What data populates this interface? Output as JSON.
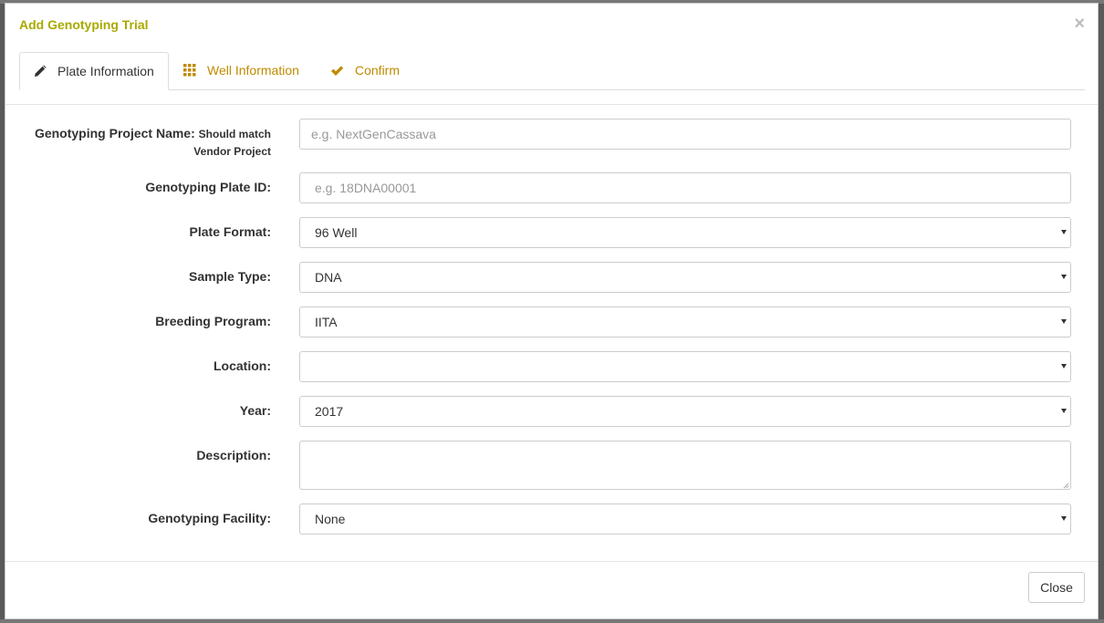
{
  "modal": {
    "title": "Add Genotyping Trial",
    "close_symbol": "×",
    "close_button": "Close"
  },
  "tabs": [
    {
      "label": "Plate Information",
      "icon": "pencil-icon",
      "active": true
    },
    {
      "label": "Well Information",
      "icon": "grid-icon",
      "active": false
    },
    {
      "label": "Confirm",
      "icon": "checkmark-icon",
      "active": false
    }
  ],
  "form": {
    "project_name": {
      "label": "Genotyping Project Name:",
      "hint": "Should match Vendor Project",
      "placeholder": "e.g. NextGenCassava",
      "value": ""
    },
    "plate_id": {
      "label": "Genotyping Plate ID:",
      "placeholder": "e.g. 18DNA00001",
      "value": ""
    },
    "plate_format": {
      "label": "Plate Format:",
      "value": "96 Well"
    },
    "sample_type": {
      "label": "Sample Type:",
      "value": "DNA"
    },
    "breeding_program": {
      "label": "Breeding Program:",
      "value": "IITA"
    },
    "location": {
      "label": "Location:",
      "value": ""
    },
    "year": {
      "label": "Year:",
      "value": "2017"
    },
    "description": {
      "label": "Description:",
      "value": ""
    },
    "genotyping_facility": {
      "label": "Genotyping Facility:",
      "value": "None"
    }
  },
  "colors": {
    "title": "#a9a900",
    "tab_link": "#c08a00",
    "text": "#333333",
    "placeholder": "#999999"
  }
}
